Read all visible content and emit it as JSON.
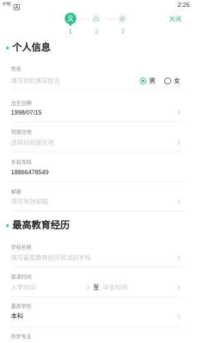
{
  "theme": {
    "accent": "#2fc48f",
    "section_dot": "#3cc7b4"
  },
  "status_bar": {
    "indicator_text": "护眼",
    "notification_icon": "app-a-icon",
    "time": "2:26"
  },
  "header": {
    "close_label": "关闭",
    "steps": [
      {
        "number": "1",
        "icon": "person-icon",
        "active": true
      },
      {
        "number": "2",
        "icon": "briefcase-icon",
        "active": false
      },
      {
        "number": "3",
        "icon": "plus-circle-icon",
        "active": false
      }
    ]
  },
  "sections": {
    "personal": {
      "title": "个人信息",
      "name": {
        "label": "姓名",
        "placeholder": "填写你的真实姓名",
        "gender": {
          "male": "男",
          "female": "女"
        },
        "gender_selected": "男"
      },
      "birth": {
        "label": "出生日期",
        "value": "1998/07/15"
      },
      "residence": {
        "label": "现居住地",
        "placeholder": "选择目前居住地"
      },
      "phone": {
        "label": "手机号码",
        "value": "18866478549"
      },
      "email": {
        "label": "邮箱",
        "placeholder": "填写有效邮箱"
      }
    },
    "education": {
      "title": "最高教育经历",
      "school": {
        "label": "学校名称",
        "placeholder": "填写最高教育经历就读的学校"
      },
      "period": {
        "label": "就读时间",
        "start_placeholder": "入学时间",
        "separator": "至",
        "end_placeholder": "毕业时间"
      },
      "degree": {
        "label": "最高学历",
        "value": "本科"
      },
      "major": {
        "label": "所学专业"
      }
    }
  }
}
